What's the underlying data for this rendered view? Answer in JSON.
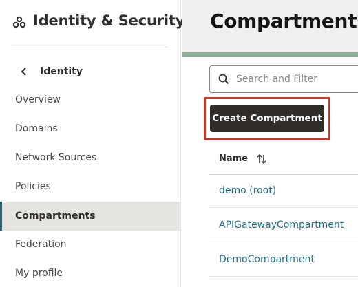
{
  "sidebar": {
    "brand": {
      "icon": "cubes-icon",
      "title": "Identity & Security"
    },
    "back": {
      "icon": "chevron-left-icon",
      "label": "Identity"
    },
    "items": [
      {
        "label": "Overview",
        "active": false
      },
      {
        "label": "Domains",
        "active": false
      },
      {
        "label": "Network Sources",
        "active": false
      },
      {
        "label": "Policies",
        "active": false
      },
      {
        "label": "Compartments",
        "active": true
      },
      {
        "label": "Federation",
        "active": false
      },
      {
        "label": "My profile",
        "active": false
      }
    ]
  },
  "main": {
    "title": "Compartments",
    "search": {
      "placeholder": "Search and Filter",
      "value": "",
      "icon": "search-icon"
    },
    "create_button": {
      "label": "Create Compartment"
    },
    "table": {
      "columns": [
        {
          "label": "Name",
          "sort_icon": "sort-icon"
        }
      ],
      "rows": [
        {
          "name": "demo (root)"
        },
        {
          "name": "APIGatewayCompartment"
        },
        {
          "name": "DemoCompartment"
        }
      ]
    }
  },
  "colors": {
    "highlight": "#c0392b",
    "link": "#1f6e85",
    "primary_button": "#312d2a",
    "active_nav_bg": "#e6e4e1"
  }
}
